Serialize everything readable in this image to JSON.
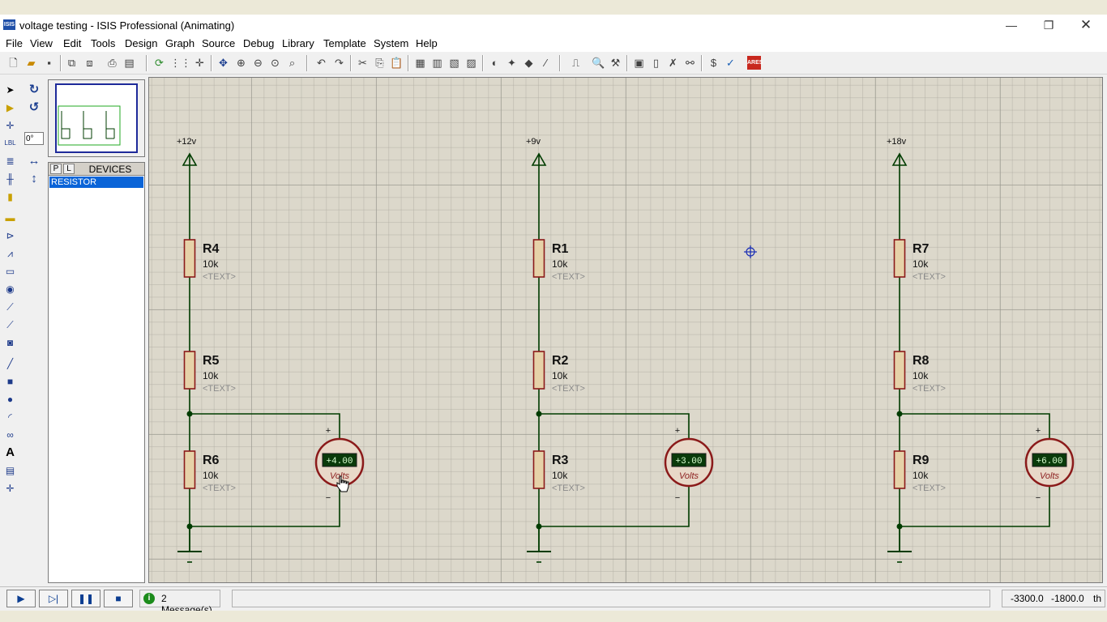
{
  "window": {
    "title": "voltage testing - ISIS Professional (Animating)",
    "app_icon_text": "ISIS",
    "min_glyph": "—",
    "max_glyph": "❐",
    "close_glyph": "✕"
  },
  "menu": [
    "File",
    "View",
    "Edit",
    "Tools",
    "Design",
    "Graph",
    "Source",
    "Debug",
    "Library",
    "Template",
    "System",
    "Help"
  ],
  "toolbar_icons": [
    "new-file-icon",
    "open-folder-icon",
    "save-icon",
    "import-icon",
    "export-icon",
    "print-icon",
    "print-area-icon",
    "refresh-icon",
    "grid-icon",
    "origin-icon",
    "pan-icon",
    "zoom-in-icon",
    "zoom-out-icon",
    "zoom-all-icon",
    "zoom-area-icon",
    "undo-icon",
    "redo-icon",
    "cut-icon",
    "copy-icon",
    "paste-icon",
    "block-copy-icon",
    "block-move-icon",
    "block-rotate-icon",
    "block-delete-icon",
    "pick-device-icon",
    "make-device-icon",
    "package-icon",
    "decompose-icon",
    "wire-autorouter-icon",
    "search-icon",
    "property-tool-icon",
    "design-explorer-icon",
    "new-sheet-icon",
    "remove-sheet-icon",
    "netlist-icon",
    "bill-of-materials-icon",
    "electrical-check-icon",
    "ares-icon"
  ],
  "left_tools": [
    "selection-icon",
    "component-icon",
    "junction-icon",
    "wire-label-icon",
    "text-script-icon",
    "buses-icon",
    "subcircuit-icon",
    "terminals-icon",
    "device-pins-icon",
    "graph-icon",
    "tape-recorder-icon",
    "generator-icon",
    "voltage-probe-icon",
    "current-probe-icon",
    "virtual-instruments-icon",
    "line-icon",
    "box-icon",
    "circle-icon",
    "arc-icon",
    "path-icon",
    "text-icon",
    "symbol-icon",
    "marker-icon"
  ],
  "rotation": {
    "angle": "0°"
  },
  "devices": {
    "tab_p": "P",
    "tab_l": "L",
    "header": "DEVICES",
    "items": [
      "RESISTOR"
    ]
  },
  "circuits": [
    {
      "supply": "+12v",
      "resistors": [
        {
          "ref": "R4",
          "value": "10k",
          "text": "<TEXT>"
        },
        {
          "ref": "R5",
          "value": "10k",
          "text": "<TEXT>"
        },
        {
          "ref": "R6",
          "value": "10k",
          "text": "<TEXT>"
        }
      ],
      "meter": {
        "reading": "+4.00",
        "unit": "Volts",
        "plus": "+",
        "minus": "−"
      }
    },
    {
      "supply": "+9v",
      "resistors": [
        {
          "ref": "R1",
          "value": "10k",
          "text": "<TEXT>"
        },
        {
          "ref": "R2",
          "value": "10k",
          "text": "<TEXT>"
        },
        {
          "ref": "R3",
          "value": "10k",
          "text": "<TEXT>"
        }
      ],
      "meter": {
        "reading": "+3.00",
        "unit": "Volts",
        "plus": "+",
        "minus": "−"
      }
    },
    {
      "supply": "+18v",
      "resistors": [
        {
          "ref": "R7",
          "value": "10k",
          "text": "<TEXT>"
        },
        {
          "ref": "R8",
          "value": "10k",
          "text": "<TEXT>"
        },
        {
          "ref": "R9",
          "value": "10k",
          "text": "<TEXT>"
        }
      ],
      "meter": {
        "reading": "+6.00",
        "unit": "Volts",
        "plus": "+",
        "minus": "−"
      }
    }
  ],
  "status": {
    "play": "▶",
    "step": "▷|",
    "pause": "❚❚",
    "stop": "■",
    "info_glyph": "i",
    "messages": "2 Message(s)",
    "coord_x": "-3300.0",
    "coord_y": "-1800.0",
    "coord_unit": "th"
  },
  "colors": {
    "wire": "#003c00",
    "resistor_body": "#e6d2a8",
    "resistor_outline": "#8b1a1a",
    "meter_face": "#e8d8c8",
    "meter_display": "#0a3a0a",
    "canvas": "#dcd8cb",
    "cursor_marker": "#1a2fb5"
  }
}
